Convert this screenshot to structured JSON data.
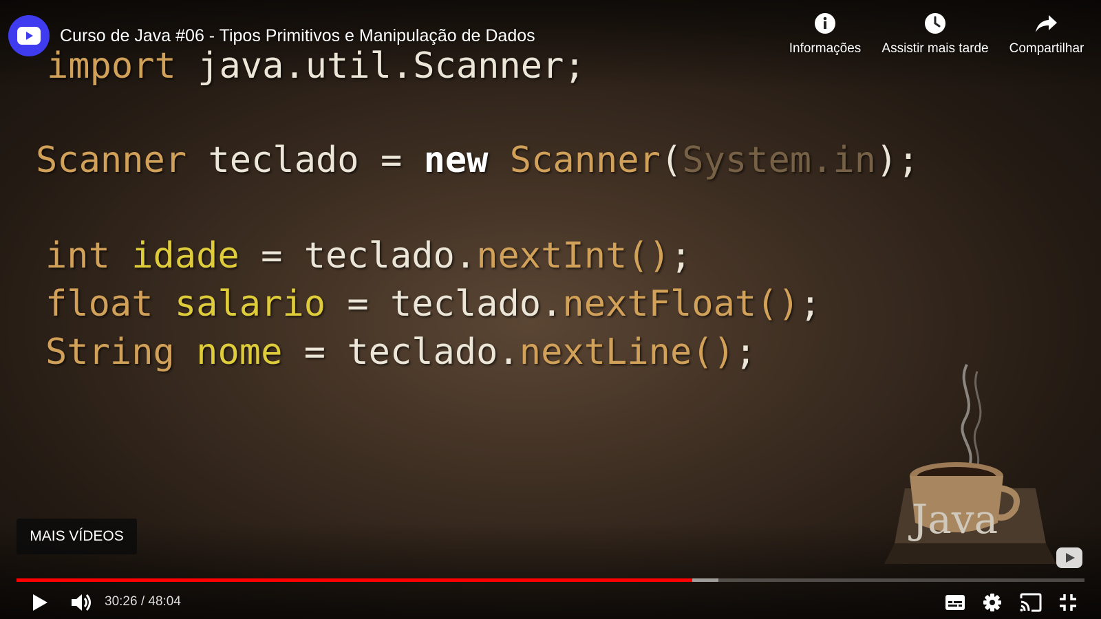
{
  "video": {
    "title": "Curso de Java #06 - Tipos Primitivos e Manipulação de Dados",
    "progress_fraction": 0.633,
    "buffered_fraction": 0.657
  },
  "top_actions": {
    "info": {
      "label": "Informações",
      "icon": "info-icon"
    },
    "watch_later": {
      "label": "Assistir mais tarde",
      "icon": "clock-icon"
    },
    "share": {
      "label": "Compartilhar",
      "icon": "share-arrow-icon"
    }
  },
  "slide": {
    "line1": {
      "keyword": "import",
      "rest": "java.util.Scanner;"
    },
    "line2": {
      "type": "Scanner",
      "var": "teclado",
      "eq": "=",
      "new": "new",
      "ctor": "Scanner",
      "paren_open": "(",
      "arg": "System.in",
      "paren_close": ");"
    },
    "line3": {
      "type": "int",
      "var": "idade",
      "eq": "=",
      "obj": "teclado",
      "dot": ".",
      "method": "nextInt()",
      "semi": ";"
    },
    "line4": {
      "type": "float",
      "var": "salario",
      "eq": "=",
      "obj": "teclado",
      "dot": ".",
      "method": "nextFloat()",
      "semi": ";"
    },
    "line5": {
      "type": "String",
      "var": "nome",
      "eq": "=",
      "obj": "teclado",
      "dot": ".",
      "method": "nextLine()",
      "semi": ";"
    },
    "watermark_text": "Java"
  },
  "overlay": {
    "more_videos_label": "MAIS VÍDEOS"
  },
  "controls": {
    "current_time": "30:26",
    "duration": "48:04",
    "time_text": "30:26 / 48:04",
    "icons": [
      "play-icon",
      "volume-icon",
      "subtitles-icon",
      "settings-gear-icon",
      "cast-icon",
      "exit-fullscreen-icon"
    ]
  },
  "colors": {
    "progress_played": "#ff0000",
    "channel_avatar": "#3f3cf0",
    "code_keyword": "#d2a159",
    "code_variable": "#dfcc3b",
    "code_plain": "#ece6d8"
  }
}
